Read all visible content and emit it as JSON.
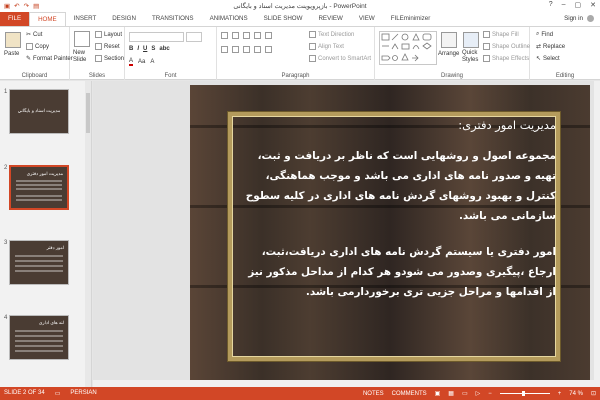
{
  "window": {
    "title": "بازپروپوینت مدیریت اسناد و بایگانی - PowerPoint",
    "help": "?",
    "min": "–",
    "max": "▢",
    "close": "✕"
  },
  "tabs": [
    "FILE",
    "HOME",
    "INSERT",
    "DESIGN",
    "TRANSITIONS",
    "ANIMATIONS",
    "SLIDE SHOW",
    "REVIEW",
    "VIEW",
    "FILEminimizer"
  ],
  "signin": "Sign in",
  "ribbon": {
    "clipboard": {
      "label": "Clipboard",
      "paste": "Paste",
      "cut": "Cut",
      "copy": "Copy",
      "format_painter": "Format Painter"
    },
    "slides": {
      "label": "Slides",
      "new_slide": "New Slide",
      "layout": "Layout",
      "reset": "Reset",
      "section": "Section"
    },
    "font": {
      "label": "Font"
    },
    "paragraph": {
      "label": "Paragraph",
      "text_direction": "Text Direction",
      "align_text": "Align Text",
      "convert": "Convert to SmartArt"
    },
    "drawing": {
      "label": "Drawing",
      "arrange": "Arrange",
      "quick_styles": "Quick Styles",
      "shape_fill": "Shape Fill",
      "shape_outline": "Shape Outline",
      "shape_effects": "Shape Effects"
    },
    "editing": {
      "label": "Editing",
      "find": "Find",
      "replace": "Replace",
      "select": "Select"
    }
  },
  "thumbnails": [
    {
      "num": "1",
      "title": "مديريت اسناد و بايگاني"
    },
    {
      "num": "2",
      "title": "مدیریت امور دفتری"
    },
    {
      "num": "3",
      "title": "امور دفتر"
    },
    {
      "num": "4",
      "title": "لنه های اداری"
    }
  ],
  "slide": {
    "heading": "مدیریت امور دفتری:",
    "para1": "مجموعه اصول و روشهایی است که ناظر بر دریافت و ثبت، تهیه و صدور نامه های اداری می باشد و موجب هماهنگی، کنترل و بهبود روشهای گردش نامه های اداری در کلیه سطوح سازمانی می باشد.",
    "para2": "امور دفتری یا سیستم گردش نامه های اداری دریافت،ثبت، ارجاع ،پیگیری وصدور می شودو هر کدام از مداحل مذکور نیز از اقدامها و مراحل جزیی تری برخوردارمی باشد."
  },
  "status": {
    "slide": "SLIDE 2 OF 34",
    "lang": "PERSIAN",
    "notes": "NOTES",
    "comments": "COMMENTS",
    "zoom": "74 %"
  },
  "colors": {
    "accent": "#d24726",
    "frame": "#b49b5c"
  }
}
